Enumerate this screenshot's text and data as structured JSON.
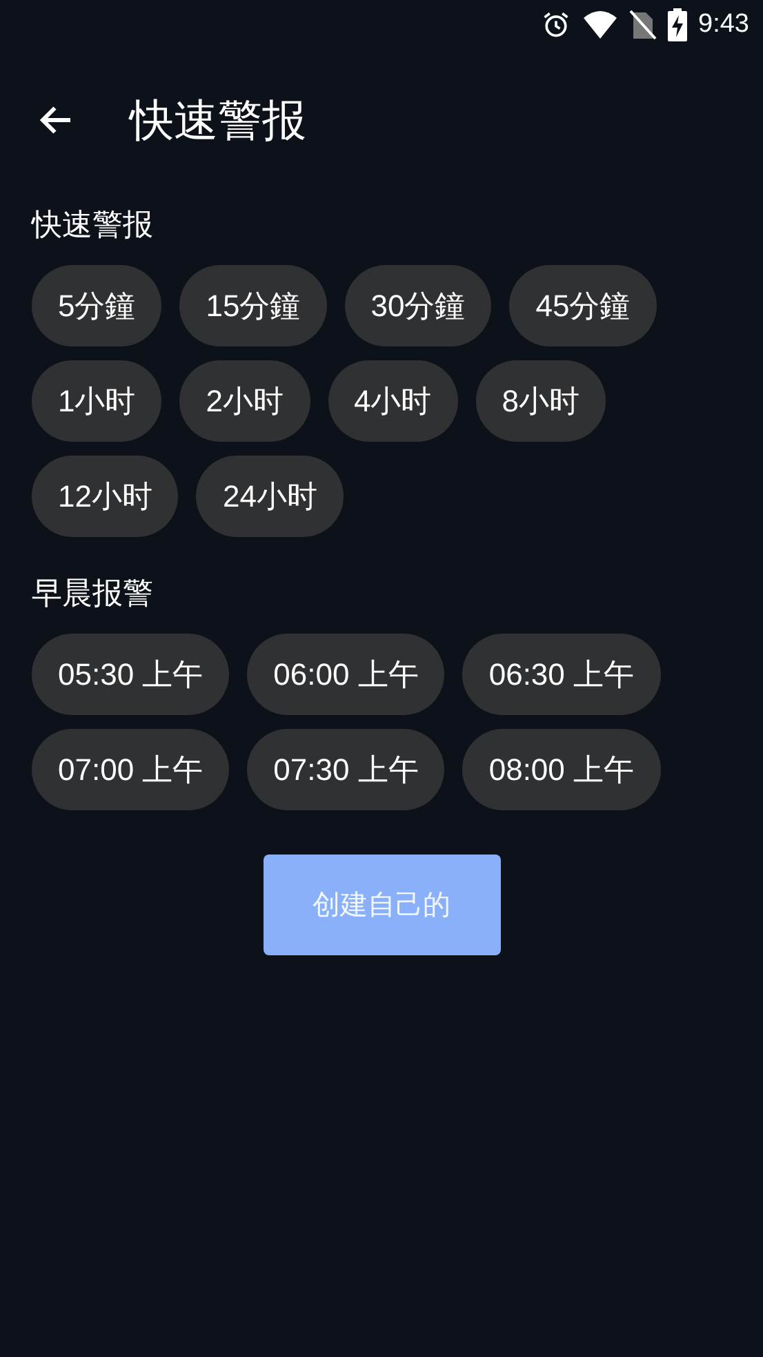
{
  "status_bar": {
    "time": "9:43"
  },
  "header": {
    "title": "快速警报"
  },
  "sections": [
    {
      "title": "快速警报",
      "chips": [
        "5分鐘",
        "15分鐘",
        "30分鐘",
        "45分鐘",
        "1小时",
        "2小时",
        "4小时",
        "8小时",
        "12小时",
        "24小时"
      ]
    },
    {
      "title": "早晨报警",
      "chips": [
        "05:30 上午",
        "06:00 上午",
        "06:30 上午",
        "07:00 上午",
        "07:30 上午",
        "08:00 上午"
      ]
    }
  ],
  "create_button": {
    "label": "创建自己的"
  }
}
